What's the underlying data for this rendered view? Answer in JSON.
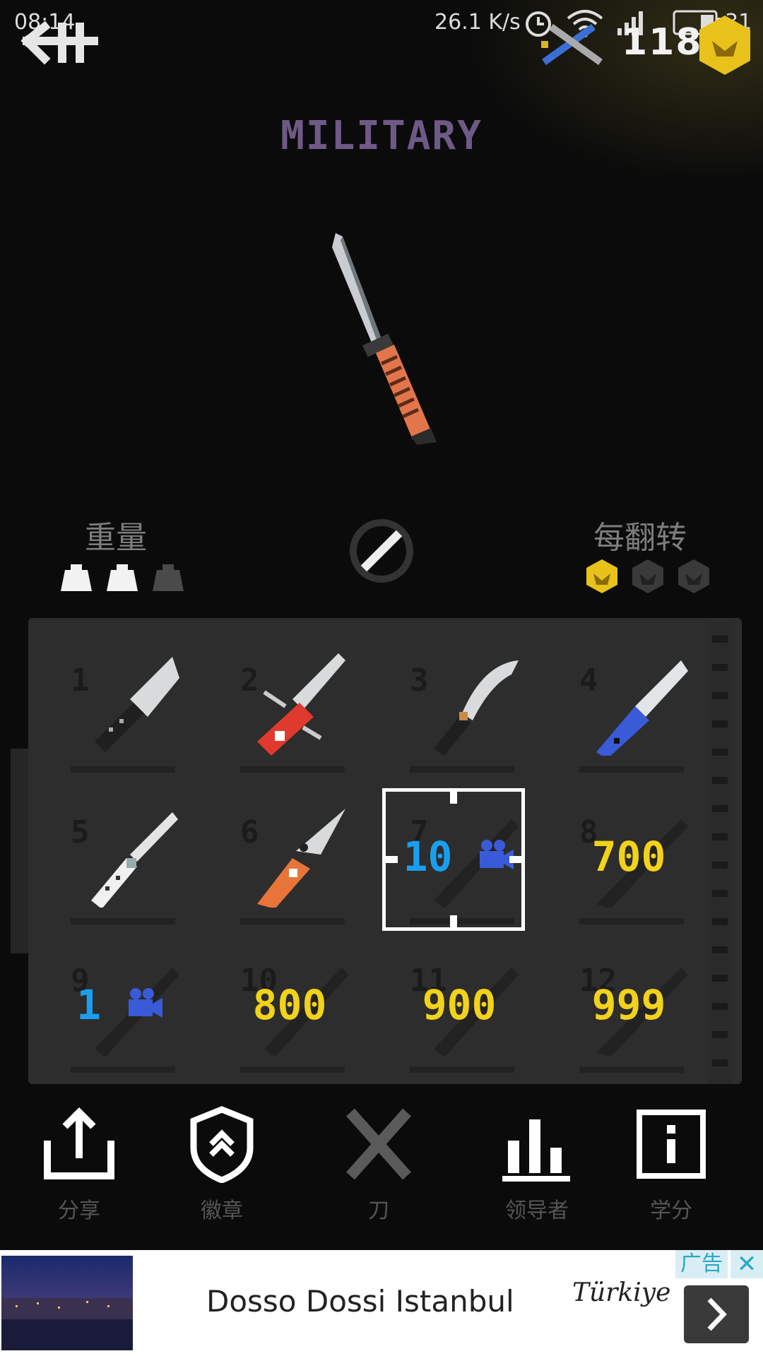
{
  "status_bar": {
    "time": "08:14",
    "net_speed": "26.1 K/s",
    "battery": "31"
  },
  "header": {
    "coins": "1181",
    "category_title": "MILITARY"
  },
  "stats": {
    "weight_label": "重量",
    "weight_level": 2,
    "weight_max": 3,
    "per_flip_label": "每翻转",
    "per_flip_level": 1,
    "per_flip_max": 3
  },
  "grid": {
    "items": [
      {
        "num": "1",
        "state": "owned",
        "icon": "cleaver-knife-icon"
      },
      {
        "num": "2",
        "state": "owned",
        "icon": "swiss-army-knife-icon"
      },
      {
        "num": "3",
        "state": "owned",
        "icon": "kukri-knife-icon"
      },
      {
        "num": "4",
        "state": "owned",
        "icon": "blue-handle-knife-icon"
      },
      {
        "num": "5",
        "state": "owned",
        "icon": "butterfly-knife-icon"
      },
      {
        "num": "6",
        "state": "owned",
        "icon": "folding-orange-knife-icon"
      },
      {
        "num": "7",
        "state": "video",
        "cost": "10",
        "icon": "video-camera-icon"
      },
      {
        "num": "8",
        "state": "price",
        "cost": "700"
      },
      {
        "num": "9",
        "state": "video",
        "cost": "1",
        "icon": "video-camera-icon"
      },
      {
        "num": "10",
        "state": "price",
        "cost": "800"
      },
      {
        "num": "11",
        "state": "price",
        "cost": "900"
      },
      {
        "num": "12",
        "state": "price",
        "cost": "999"
      }
    ],
    "selected_index": 7
  },
  "nav": {
    "share": "分享",
    "badges": "徽章",
    "knives": "刀",
    "leaderboard": "领导者",
    "credits": "学分"
  },
  "ad": {
    "tag": "广告",
    "close": "✕",
    "title": "Dosso Dossi Istanbul",
    "brand": "Türkiye"
  },
  "colors": {
    "price": "#f2d21a",
    "video": "#1a9ff0",
    "title": "#6e5a86",
    "panel": "#2d2d2d"
  }
}
